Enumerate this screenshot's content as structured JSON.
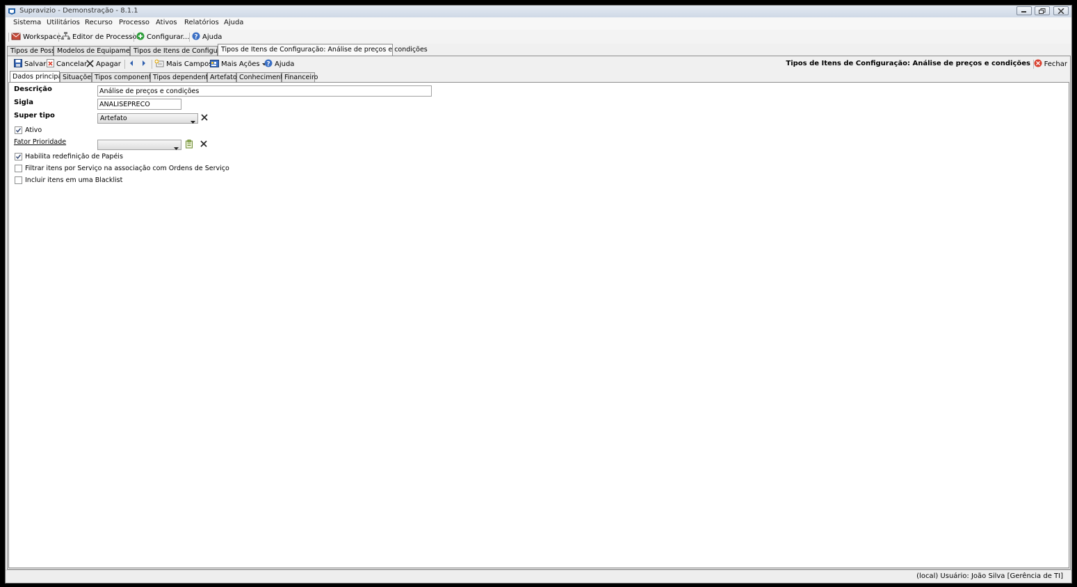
{
  "window": {
    "title": "Supravizio - Demonstração - 8.1.1",
    "controls": [
      "minimize",
      "restore",
      "close"
    ]
  },
  "menu": {
    "items": [
      "Sistema",
      "Utilitários",
      "Recurso",
      "Processo",
      "Ativos",
      "Relatórios",
      "Ajuda"
    ]
  },
  "toolbar": {
    "workspace": "Workspace",
    "process_editor": "Editor de Processos",
    "configure": "Configurar...",
    "help": "Ajuda"
  },
  "doc_tabs": {
    "items": [
      "Tipos de Posse",
      "Modelos de Equipamentos",
      "Tipos de Itens de Configuração",
      "Tipos de Itens de Configuração: Análise de preços e condições"
    ],
    "active": "Tipos de Itens de Configuração: Análise de preços e condições"
  },
  "form_toolbar": {
    "save": "Salvar",
    "cancel": "Cancelar",
    "delete": "Apagar",
    "more_fields": "Mais Campos",
    "more_actions": "Mais Ações",
    "help": "Ajuda",
    "form_title": "Tipos de Itens de Configuração: Análise de preços e condições",
    "close": "Fechar"
  },
  "sub_tabs": {
    "items": [
      "Dados principais",
      "Situações",
      "Tipos componentes",
      "Tipos dependentes",
      "Artefatos",
      "Conhecimento",
      "Financeiro"
    ],
    "active": "Dados principais"
  },
  "form": {
    "descricao_label": "Descrição",
    "descricao_value": "Análise de preços e condições",
    "sigla_label": "Sigla",
    "sigla_value": "ANALISEPRECO",
    "super_tipo_label": "Super tipo",
    "super_tipo_value": "Artefato",
    "ativo_label": "Ativo",
    "ativo_checked": true,
    "fator_prioridade_label": "Fator Prioridade",
    "fator_prioridade_value": "",
    "habilita_label": "Habilita redefinição de Papéis",
    "habilita_checked": true,
    "filtrar_label": "Filtrar itens por Serviço na associação com Ordens de Serviço",
    "filtrar_checked": false,
    "blacklist_label": "Incluir itens em uma Blacklist",
    "blacklist_checked": false
  },
  "status": {
    "text": "(local)  Usuário: João Silva [Gerência de TI]"
  },
  "colors": {
    "accent": "#1f5fa8",
    "title_gradient_top": "#e3eaf3",
    "close_red": "#d9402e",
    "ok_green": "#2e9e3a"
  }
}
